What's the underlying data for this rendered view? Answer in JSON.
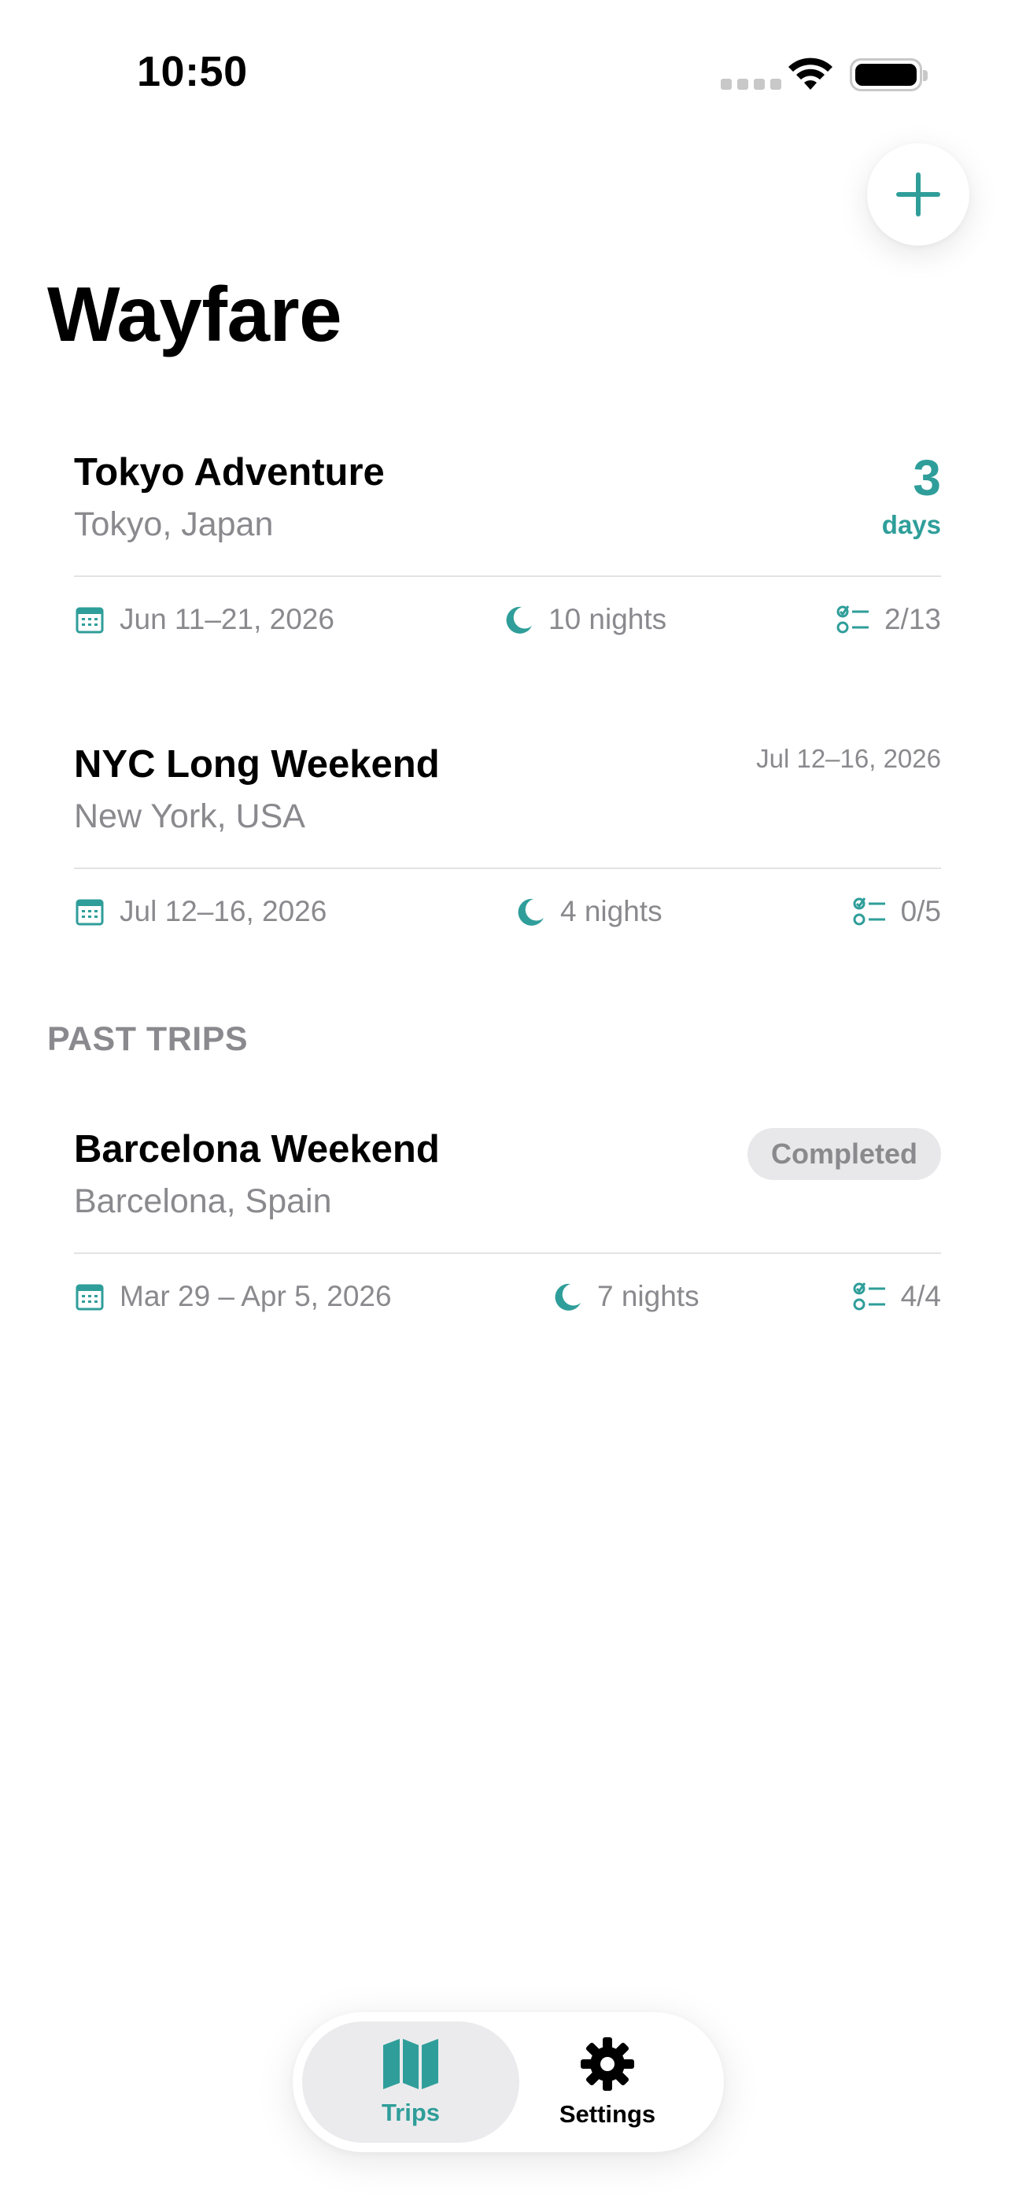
{
  "status_bar": {
    "time": "10:50"
  },
  "header": {
    "title": "Wayfare",
    "add_icon": "plus-icon"
  },
  "upcoming_trips": [
    {
      "title": "Tokyo Adventure",
      "location": "Tokyo, Japan",
      "countdown_value": "3",
      "countdown_unit": "days",
      "dates": "Jun 11–21, 2026",
      "nights": "10 nights",
      "checklist": "2/13"
    },
    {
      "title": "NYC Long Weekend",
      "location": "New York, USA",
      "date_right": "Jul 12–16, 2026",
      "dates": "Jul 12–16, 2026",
      "nights": "4 nights",
      "checklist": "0/5"
    }
  ],
  "past_section": {
    "header": "PAST TRIPS"
  },
  "past_trips": [
    {
      "title": "Barcelona Weekend",
      "location": "Barcelona, Spain",
      "badge": "Completed",
      "dates": "Mar 29 – Apr 5, 2026",
      "nights": "7 nights",
      "checklist": "4/4"
    }
  ],
  "tab_bar": {
    "tabs": [
      {
        "label": "Trips",
        "icon": "map-icon",
        "active": true
      },
      {
        "label": "Settings",
        "icon": "gear-icon",
        "active": false
      }
    ]
  },
  "colors": {
    "accent": "#2f9e9a",
    "secondary_text": "#8a8a8e",
    "divider": "#e3e3e6",
    "badge_bg": "#e8e8ea"
  }
}
